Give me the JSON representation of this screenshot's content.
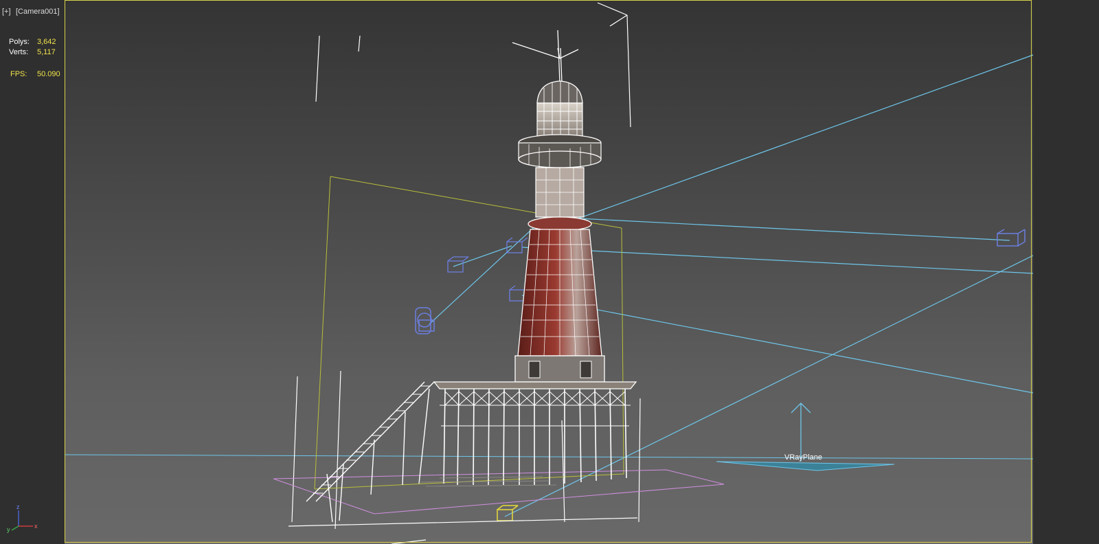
{
  "viewport": {
    "menu_plus": "[+]",
    "menu_camera": "[Camera001]"
  },
  "stats": {
    "polys_label": "Polys:",
    "polys_value": "3,642",
    "verts_label": "Verts:",
    "verts_value": "5,117",
    "fps_label": "FPS:",
    "fps_value": "50.090"
  },
  "scene": {
    "object_label": "VRayPlane"
  },
  "axis_gizmo": {
    "z": "z",
    "y": "y",
    "x": "x"
  },
  "colors": {
    "active_frame": "#d8d24a",
    "light_helpers": "#6ec6ea",
    "wireframe": "#ffffff",
    "tower_red": "#7a2a22",
    "bounding_box": "#b9bf3a",
    "ground_gizmo": "#d08fe0"
  }
}
